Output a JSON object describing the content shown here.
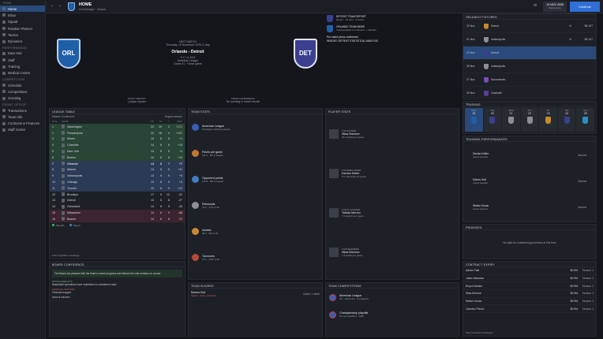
{
  "sidebar": {
    "sections": [
      {
        "title": "TEAM",
        "items": [
          "Home",
          "Inbox",
          "Squad",
          "Rotation Planner",
          "Tactics",
          "Dynamics"
        ]
      },
      {
        "title": "PERFORMANCE",
        "items": [
          "Data Hub",
          "Staff",
          "Training",
          "Medical Centre"
        ]
      },
      {
        "title": "COMPETITION",
        "items": [
          "Schedule",
          "Competitions",
          "Scouting"
        ]
      },
      {
        "title": "FRONT OFFICE",
        "items": [
          "Transactions",
          "Team Info",
          "Contracts & Finances",
          "Staff Center"
        ]
      }
    ]
  },
  "topbar": {
    "title": "HOME",
    "subtitle": "Club Manager · Orlando",
    "date": "19 NOV 2026",
    "date_sub": "Wednesday",
    "continue": "Continue"
  },
  "match": {
    "label": "NEXT MATCH",
    "date": "Thursday, 19 November 2026 | 1 day",
    "teams": "Orlando - Detroit",
    "record": "9-7 | vs 16-5",
    "competition": "American League",
    "game": "Game 21 · Home game",
    "home_abbr": "ORL",
    "away_abbr": "DET",
    "left_note_label": "INJURY REPORT",
    "left_note": "1 player injured",
    "right_note_label": "PRESS CONFERENCE",
    "right_note": "No meeting in recent results"
  },
  "news": [
    {
      "title": "DETROIT TEAM REPORT",
      "sub": "Report · 16 wins · 5 losses"
    },
    {
      "title": "ORLANDO TEAM NEWS",
      "sub": "Training Week 1 in Review — Orlando"
    },
    {
      "title": "Pre-match press conference",
      "sub": ""
    },
    {
      "title": "INSIGHT: DETROIT STATISTICAL ANALYSIS",
      "sub": ""
    }
  ],
  "fixtures": {
    "title": "ORLANDO FIXTURES",
    "rows": [
      {
        "date": "19 Nov",
        "vs": "Detroit",
        "res": "W",
        "score": "98-107"
      },
      {
        "date": "21 Nov",
        "vs": "Indianapolis",
        "res": "W",
        "score": "98-107"
      },
      {
        "date": "23 Nov",
        "vs": "Detroit",
        "res": "",
        "score": ""
      },
      {
        "date": "25 Nov",
        "vs": "Indianapolis",
        "res": "",
        "score": ""
      },
      {
        "date": "27 Nov",
        "vs": "Sacramento",
        "res": "",
        "score": ""
      },
      {
        "date": "29 Nov",
        "vs": "Charlotte",
        "res": "",
        "score": ""
      }
    ]
  },
  "training": {
    "title": "TRAINING",
    "days": [
      {
        "d": "Mon",
        "n": "19"
      },
      {
        "d": "Tue",
        "n": "20"
      },
      {
        "d": "Wed",
        "n": "21"
      },
      {
        "d": "Thu",
        "n": "22"
      },
      {
        "d": "Fri",
        "n": "23"
      },
      {
        "d": "Sat",
        "n": "24"
      },
      {
        "d": "Sun",
        "n": "25"
      }
    ]
  },
  "training_perf": {
    "title": "TRAINING PERFORMANCES",
    "rows": [
      {
        "name": "Declan Keller",
        "sub": "Latest session",
        "val": "Normal"
      },
      {
        "name": "Darius Holt",
        "sub": "Latest session",
        "val": "Normal"
      },
      {
        "name": "Stefan Kovac",
        "sub": "Latest session",
        "val": "Normal"
      }
    ]
  },
  "promises": {
    "title": "PROMISES",
    "empty": "No data for outstanding promises at this time"
  },
  "contract": {
    "title": "CONTRACT EXPIRY",
    "rows": [
      {
        "name": "Adrian Falk",
        "val": "$0.9M",
        "yrs": "Season 1"
      },
      {
        "name": "Julian Marceau",
        "val": "$0.9M",
        "yrs": "Season 1"
      },
      {
        "name": "Royce Benton",
        "val": "$0.9M",
        "yrs": "Season 1"
      },
      {
        "name": "Silas Monroe",
        "val": "$0.9M",
        "yrs": "Season 1"
      },
      {
        "name": "Stefan Kovac",
        "val": "$0.9M",
        "yrs": "Season 1"
      },
      {
        "name": "Camden Pierce",
        "val": "$0.9M",
        "yrs": "Season 1"
      }
    ],
    "footer": "View contracts & finances"
  },
  "league": {
    "title": "LEAGUE TABLE",
    "sub": "Eastern Conference",
    "sub_right": "Regular season",
    "headers": [
      "POS",
      "TEAM",
      "GP",
      "W",
      "L",
      "DIFF"
    ],
    "rows": [
      {
        "pos": "1",
        "team": "Washington",
        "gp": "22",
        "w": "19",
        "l": "3",
        "d": "+171",
        "cls": "g"
      },
      {
        "pos": "2",
        "team": "Philadelphia",
        "gp": "22",
        "w": "18",
        "l": "4",
        "d": "+101",
        "cls": "g"
      },
      {
        "pos": "3",
        "team": "Miami",
        "gp": "14",
        "w": "8",
        "l": "6",
        "d": "+1",
        "cls": "g"
      },
      {
        "pos": "4",
        "team": "Charlotte",
        "gp": "14",
        "w": "8",
        "l": "6",
        "d": "+15",
        "cls": "g"
      },
      {
        "pos": "5",
        "team": "New York",
        "gp": "14",
        "w": "8",
        "l": "6",
        "d": "+4",
        "cls": "g"
      },
      {
        "pos": "6",
        "team": "Boston",
        "gp": "14",
        "w": "8",
        "l": "6",
        "d": "+10",
        "cls": "g"
      },
      {
        "pos": "7",
        "team": "Orlando",
        "gp": "14",
        "w": "8",
        "l": "7",
        "d": "+7",
        "cls": "b"
      },
      {
        "pos": "8",
        "team": "Atlanta",
        "gp": "14",
        "w": "8",
        "l": "6",
        "d": "+11",
        "cls": "b"
      },
      {
        "pos": "9",
        "team": "Indianapolis",
        "gp": "13",
        "w": "8",
        "l": "5",
        "d": "+5",
        "cls": "b"
      },
      {
        "pos": "10",
        "team": "Chicago",
        "gp": "13",
        "w": "8",
        "l": "5",
        "d": "+3",
        "cls": "b"
      },
      {
        "pos": "11",
        "team": "Toronto",
        "gp": "13",
        "w": "8",
        "l": "5",
        "d": "+12",
        "cls": "b"
      },
      {
        "pos": "12",
        "team": "Brooklyn",
        "gp": "17",
        "w": "5",
        "l": "12",
        "d": "-32",
        "cls": ""
      },
      {
        "pos": "13",
        "team": "Detroit",
        "gp": "13",
        "w": "5",
        "l": "8",
        "d": "-27",
        "cls": ""
      },
      {
        "pos": "14",
        "team": "Cleveland",
        "gp": "14",
        "w": "5",
        "l": "9",
        "d": "-43",
        "cls": ""
      },
      {
        "pos": "15",
        "team": "Milwaukee",
        "gp": "14",
        "w": "6",
        "l": "9",
        "d": "-66",
        "cls": "r"
      },
      {
        "pos": "16",
        "team": "Boston",
        "gp": "14",
        "w": "6",
        "l": "8",
        "d": "-72",
        "cls": "r"
      }
    ],
    "legend": [
      "Playoffs",
      "Play-In"
    ],
    "footer": "Full competition standings"
  },
  "board": {
    "title": "BOARD CONFIDENCE",
    "msg": "The Board are pleased with the team's overall progress and believe the club remains on course",
    "items": [
      {
        "label": "RATINGS/RESULTS",
        "text": "Basketball operations have maintained a consistent roster",
        "color": "#7fb08a"
      },
      {
        "label": "FINANCIAL SUPPORT",
        "text": "Financial support",
        "color": "#c46a6a"
      },
      {
        "label": "",
        "text": "Area of concern",
        "color": "#9aa0a9"
      }
    ]
  },
  "team_stats": {
    "title": "TEAM STATS",
    "rows": [
      {
        "name": "American League",
        "sub": "16 league matches played"
      },
      {
        "name": "Points per game",
        "sub": "111.2 · 9th in league"
      },
      {
        "name": "Opponent points",
        "sub": "110.8 · 8th in league"
      },
      {
        "name": "Rebounds",
        "sub": "43.6 · 17th of 30"
      },
      {
        "name": "Assists",
        "sub": "28.4 · 5th of 30"
      },
      {
        "name": "Turnovers",
        "sub": "13.1 · 12th of 30"
      }
    ]
  },
  "player_stats": {
    "title": "PLAYER STATS",
    "rows": [
      {
        "label": "TOP SCORER",
        "name": "Silas Brenner",
        "sub": "22.4 points per game"
      },
      {
        "label": "TOP REBOUNDER",
        "name": "Declan Keller",
        "sub": "9.1 rebounds per game"
      },
      {
        "label": "TOP PLAYMAKER",
        "name": "Tobias Mercer",
        "sub": "7.2 assists per game"
      },
      {
        "label": "TOP DEFENDER",
        "name": "Silas Brenner",
        "sub": "1.9 steals per game"
      }
    ]
  },
  "team_injured": {
    "title": "TEAM INJURED",
    "rows": [
      {
        "name": "Marcus Holt",
        "sub": "Sprain · Knee contusion",
        "val": "Under 1 week"
      }
    ]
  },
  "team_comp": {
    "title": "TEAM COMPETITIONS",
    "rows": [
      {
        "name": "American League",
        "sub": "7th · 2nd of 15 · in progress"
      },
      {
        "name": "Championship playoffs",
        "sub": "Not yet qualified · 2026"
      }
    ]
  },
  "colors": {
    "accent": "#2f6fd6",
    "orlando": "#1f5fa8",
    "detroit": "#c8394a"
  }
}
